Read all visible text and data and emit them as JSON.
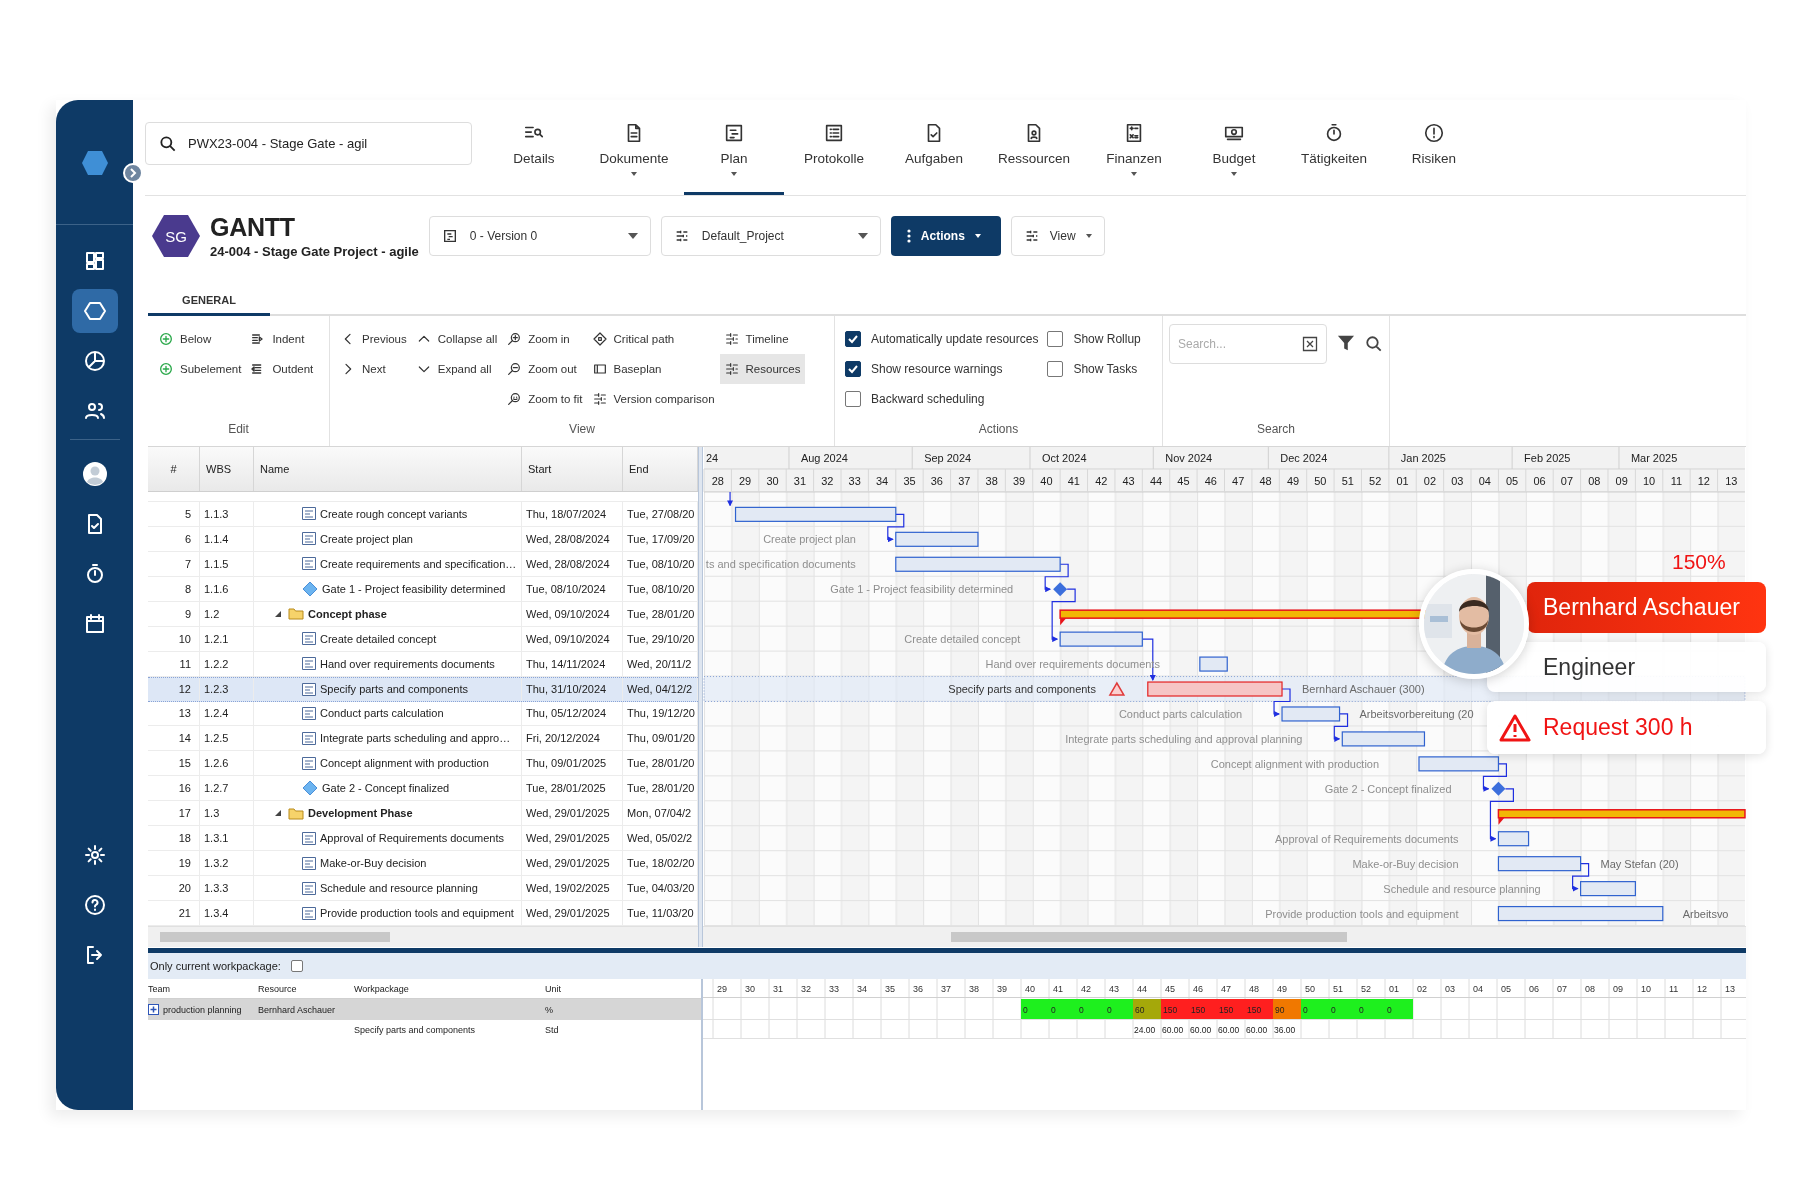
{
  "sidebar": {
    "items": [
      {
        "selected": false
      },
      {
        "selected": true
      },
      {
        "selected": false
      },
      {
        "selected": false
      }
    ],
    "personal_items": [
      {
        "selected": false
      },
      {
        "selected": false
      },
      {
        "selected": false
      },
      {
        "selected": false
      }
    ],
    "bottom_items": [
      {
        "selected": false
      },
      {
        "selected": false
      },
      {
        "selected": false
      }
    ]
  },
  "search": {
    "value": "PWX23-004 - Stage Gate - agil"
  },
  "nav_tabs": [
    {
      "label": "Details",
      "selected": false,
      "has_menu": false
    },
    {
      "label": "Dokumente",
      "selected": false,
      "has_menu": true
    },
    {
      "label": "Plan",
      "selected": true,
      "has_menu": true
    },
    {
      "label": "Protokolle",
      "selected": false,
      "has_menu": false
    },
    {
      "label": "Aufgaben",
      "selected": false,
      "has_menu": false
    },
    {
      "label": "Ressourcen",
      "selected": false,
      "has_menu": false
    },
    {
      "label": "Finanzen",
      "selected": false,
      "has_menu": true
    },
    {
      "label": "Budget",
      "selected": false,
      "has_menu": true
    },
    {
      "label": "Tätigkeiten",
      "selected": false,
      "has_menu": false
    },
    {
      "label": "Risiken",
      "selected": false,
      "has_menu": false
    }
  ],
  "header": {
    "badge": "SG",
    "title": "GANTT",
    "subtitle": "24-004 - Stage Gate Project - agile"
  },
  "toolbar": {
    "version": "0 - Version 0",
    "layout": "Default_Project",
    "actions": "Actions",
    "view": "View"
  },
  "ribbon_tabs": [
    {
      "label": "GENERAL",
      "selected": true
    }
  ],
  "ribbon": {
    "edit": {
      "label": "Edit",
      "columns": [
        [
          {
            "label": "Below"
          },
          {
            "label": "Subelement"
          }
        ],
        [
          {
            "label": "Indent"
          },
          {
            "label": "Outdent"
          }
        ]
      ]
    },
    "view": {
      "label": "View",
      "columns": [
        [
          {
            "label": "Previous",
            "selected": false
          },
          {
            "label": "Next",
            "selected": false
          }
        ],
        [
          {
            "label": "Collapse all",
            "selected": false
          },
          {
            "label": "Expand all",
            "selected": false
          }
        ],
        [
          {
            "label": "Zoom in",
            "selected": false
          },
          {
            "label": "Zoom out",
            "selected": false
          },
          {
            "label": "Zoom to fit",
            "selected": false
          }
        ],
        [
          {
            "label": "Critical path",
            "selected": false
          },
          {
            "label": "Baseplan",
            "selected": false
          },
          {
            "label": "Version comparison",
            "selected": false
          }
        ],
        [
          {
            "label": "Timeline",
            "selected": false
          },
          {
            "label": "Resources",
            "selected": true
          }
        ]
      ]
    },
    "actions": {
      "label": "Actions",
      "columns": [
        [
          {
            "label": "Automatically update resources",
            "checked": true
          },
          {
            "label": "Show resource warnings",
            "checked": true
          },
          {
            "label": "Backward scheduling",
            "checked": false
          }
        ],
        [
          {
            "label": "Show Rollup",
            "checked": false
          },
          {
            "label": "Show Tasks",
            "checked": false
          }
        ]
      ]
    },
    "search": {
      "label": "Search",
      "placeholder": "Search..."
    }
  },
  "table": {
    "columns": [
      "#",
      "WBS",
      "Name",
      "Start",
      "End"
    ],
    "rows": [
      {
        "num": "5",
        "wbs": "1.1.3",
        "name": "Create rough concept variants",
        "start": "Thu, 18/07/2024",
        "end": "Tue, 27/08/20",
        "kind": "task",
        "selected": false
      },
      {
        "num": "6",
        "wbs": "1.1.4",
        "name": "Create project plan",
        "start": "Wed, 28/08/2024",
        "end": "Tue, 17/09/20",
        "kind": "task",
        "selected": false
      },
      {
        "num": "7",
        "wbs": "1.1.5",
        "name": "Create requirements and specification…",
        "start": "Wed, 28/08/2024",
        "end": "Tue, 08/10/20",
        "kind": "task",
        "selected": false
      },
      {
        "num": "8",
        "wbs": "1.1.6",
        "name": "Gate 1 - Project feasibility determined",
        "start": "Tue, 08/10/2024",
        "end": "Tue, 08/10/20",
        "kind": "milestone",
        "selected": false
      },
      {
        "num": "9",
        "wbs": "1.2",
        "name": "Concept phase",
        "start": "Wed, 09/10/2024",
        "end": "Tue, 28/01/20",
        "kind": "summary",
        "expanded": true,
        "selected": false
      },
      {
        "num": "10",
        "wbs": "1.2.1",
        "name": "Create detailed concept",
        "start": "Wed, 09/10/2024",
        "end": "Tue, 29/10/20",
        "kind": "task",
        "selected": false
      },
      {
        "num": "11",
        "wbs": "1.2.2",
        "name": "Hand over requirements documents",
        "start": "Thu, 14/11/2024",
        "end": "Wed, 20/11/2",
        "kind": "task",
        "selected": false
      },
      {
        "num": "12",
        "wbs": "1.2.3",
        "name": "Specify parts and components",
        "start": "Thu, 31/10/2024",
        "end": "Wed, 04/12/2",
        "kind": "task",
        "selected": true
      },
      {
        "num": "13",
        "wbs": "1.2.4",
        "name": "Conduct parts calculation",
        "start": "Thu, 05/12/2024",
        "end": "Thu, 19/12/20",
        "kind": "task",
        "selected": false
      },
      {
        "num": "14",
        "wbs": "1.2.5",
        "name": "Integrate parts scheduling and appro…",
        "start": "Fri, 20/12/2024",
        "end": "Thu, 09/01/20",
        "kind": "task",
        "selected": false
      },
      {
        "num": "15",
        "wbs": "1.2.6",
        "name": "Concept alignment with production",
        "start": "Thu, 09/01/2025",
        "end": "Tue, 28/01/20",
        "kind": "task",
        "selected": false
      },
      {
        "num": "16",
        "wbs": "1.2.7",
        "name": "Gate 2 - Concept finalized",
        "start": "Tue, 28/01/2025",
        "end": "Tue, 28/01/20",
        "kind": "milestone",
        "selected": false
      },
      {
        "num": "17",
        "wbs": "1.3",
        "name": "Development Phase",
        "start": "Wed, 29/01/2025",
        "end": "Mon, 07/04/2",
        "kind": "summary",
        "expanded": true,
        "selected": false
      },
      {
        "num": "18",
        "wbs": "1.3.1",
        "name": "Approval of Requirements documents",
        "start": "Wed, 29/01/2025",
        "end": "Wed, 05/02/2",
        "kind": "task",
        "selected": false
      },
      {
        "num": "19",
        "wbs": "1.3.2",
        "name": "Make-or-Buy decision",
        "start": "Wed, 29/01/2025",
        "end": "Tue, 18/02/20",
        "kind": "task",
        "selected": false
      },
      {
        "num": "20",
        "wbs": "1.3.3",
        "name": "Schedule and resource planning",
        "start": "Wed, 19/02/2025",
        "end": "Tue, 04/03/20",
        "kind": "task",
        "selected": false
      },
      {
        "num": "21",
        "wbs": "1.3.4",
        "name": "Provide production tools and equipment",
        "start": "Wed, 29/01/2025",
        "end": "Tue, 11/03/20",
        "kind": "task",
        "selected": false
      }
    ]
  },
  "gantt": {
    "months": [
      "24",
      "Aug 2024",
      "Sep 2024",
      "Oct 2024",
      "Nov 2024",
      "Dec 2024",
      "Jan 2025",
      "Feb 2025",
      "Mar 2025"
    ],
    "weeks": [
      "28",
      "29",
      "30",
      "31",
      "32",
      "33",
      "34",
      "35",
      "36",
      "37",
      "38",
      "39",
      "40",
      "41",
      "42",
      "43",
      "44",
      "45",
      "46",
      "47",
      "48",
      "49",
      "50",
      "51",
      "52",
      "01",
      "02",
      "03",
      "04",
      "05",
      "06",
      "07",
      "08",
      "09",
      "10",
      "11",
      "12",
      "13"
    ],
    "tasks": [
      {
        "overloaded": false
      },
      {
        "label": "Create project plan",
        "overloaded": false
      },
      {
        "label": "ts and specification documents",
        "overloaded": false
      },
      {
        "label": "Gate 1 - Project feasibility determined",
        "overloaded": false
      },
      {
        "overloaded": false
      },
      {
        "label": "Create detailed concept",
        "overloaded": false
      },
      {
        "label": "Hand over requirements documents",
        "overloaded": false
      },
      {
        "label": "Specify parts and components",
        "note": "Bernhard Aschauer (300)",
        "overloaded": true
      },
      {
        "label": "Conduct parts calculation",
        "note": "Arbeitsvorbereitung (20",
        "overloaded": false
      },
      {
        "label": "Integrate parts scheduling and approval planning",
        "overloaded": false
      },
      {
        "label": "Concept alignment with production",
        "overloaded": false
      },
      {
        "label": "Gate 2 - Concept finalized",
        "overloaded": false
      },
      {
        "overloaded": false
      },
      {
        "label": "Approval of Requirements documents",
        "overloaded": false
      },
      {
        "label": "Make-or-Buy decision",
        "note": "May Stefan (20)",
        "overloaded": false
      },
      {
        "label": "Schedule and resource planning",
        "overloaded": false
      },
      {
        "label": "Provide production tools and equipment",
        "note": "Arbeitsvo",
        "overloaded": false
      }
    ]
  },
  "resource_panel": {
    "filter_label": "Only current workpackage:",
    "filter_checked": false,
    "columns": [
      "Team",
      "Resource",
      "Workpackage",
      "Unit"
    ],
    "weeks": [
      "29",
      "30",
      "31",
      "32",
      "33",
      "34",
      "35",
      "36",
      "37",
      "38",
      "39",
      "40",
      "41",
      "42",
      "43",
      "44",
      "45",
      "46",
      "47",
      "48",
      "49",
      "50",
      "51",
      "52",
      "01",
      "02",
      "03",
      "04",
      "05",
      "06",
      "07",
      "08",
      "09",
      "10",
      "11",
      "12",
      "13"
    ],
    "rows": [
      {
        "kind": "resource",
        "team": "production planning",
        "resource": "Bernhard Aschauer",
        "unit": "%",
        "expanded": false,
        "cells": [
          {
            "value": "0",
            "color": "#1ef01e"
          },
          {
            "value": "0",
            "color": "#1ef01e"
          },
          {
            "value": "0",
            "color": "#1ef01e"
          },
          {
            "value": "0",
            "color": "#1ef01e"
          },
          {
            "value": "60",
            "color": "#a5a80a"
          },
          {
            "value": "150",
            "color": "#ff1f1f"
          },
          {
            "value": "150",
            "color": "#ff1f1f"
          },
          {
            "value": "150",
            "color": "#ff1f1f"
          },
          {
            "value": "150",
            "color": "#ff1f1f"
          },
          {
            "value": "90",
            "color": "#f07800"
          },
          {
            "value": "0",
            "color": "#1ef01e"
          },
          {
            "value": "0",
            "color": "#1ef01e"
          },
          {
            "value": "0",
            "color": "#1ef01e"
          },
          {
            "value": "0",
            "color": "#1ef01e"
          }
        ]
      },
      {
        "kind": "workpackage",
        "workpackage": "Specify parts and components",
        "unit": "Std",
        "values": [
          "24.00",
          "60.00",
          "60.00",
          "60.00",
          "60.00",
          "36.00"
        ]
      }
    ]
  },
  "resource_card": {
    "load": "150%",
    "name": "Bernhard Aschauer",
    "role": "Engineer",
    "request": "Request 300 h"
  }
}
